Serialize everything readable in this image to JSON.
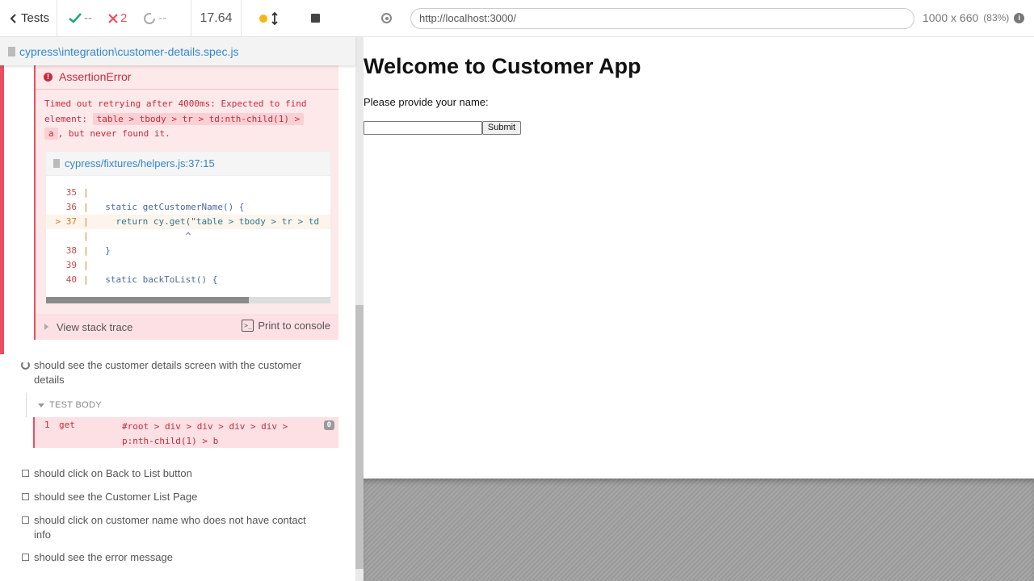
{
  "header": {
    "tests_label": "Tests",
    "passed_count": "--",
    "failed_count": "2",
    "pending_count": "--",
    "duration": "17.64"
  },
  "spec": {
    "path": "cypress\\integration\\customer-details.spec.js"
  },
  "error": {
    "name": "AssertionError",
    "message_parts": [
      "Timed out retrying after 4000ms: Expected to find",
      "element:",
      "table > tbody > tr > td:nth-child(1) >",
      "a",
      ", but never found it."
    ],
    "code_frame_file": "cypress/fixtures/helpers.js:37:15",
    "code_lines": [
      {
        "num": "35",
        "marker": "",
        "text": ""
      },
      {
        "num": "36",
        "marker": "",
        "text": "  static getCustomerName() {"
      },
      {
        "num": "37",
        "marker": ">",
        "text": "    return cy.get(\"table > tbody > tr > td"
      },
      {
        "num": "",
        "marker": "",
        "text": "                 ^"
      },
      {
        "num": "38",
        "marker": "",
        "text": "  }"
      },
      {
        "num": "39",
        "marker": "",
        "text": ""
      },
      {
        "num": "40",
        "marker": "",
        "text": "  static backToList() {"
      }
    ],
    "view_stack_trace": "View stack trace",
    "print_to_console": "Print to console"
  },
  "running_test": {
    "title": "should see the customer details screen with the customer details",
    "test_body_label": "TEST BODY",
    "command": {
      "number": "1",
      "name": "get",
      "selector": "#root > div > div > div > div > p:nth-child(1) > b",
      "count": "0"
    }
  },
  "pending_tests": [
    "should click on Back to List button",
    "should see the Customer List Page",
    "should click on customer name who does not have contact info",
    "should see the error message"
  ],
  "aut": {
    "url": "http://localhost:3000/",
    "viewport": "1000 x 660",
    "scale": "(83%)",
    "app": {
      "title": "Welcome to Customer App",
      "prompt": "Please provide your name:",
      "input_value": "",
      "submit_label": "Submit"
    }
  },
  "colors": {
    "passed": "#1fa971",
    "failed": "#e94f5f",
    "link": "#3386d4"
  }
}
